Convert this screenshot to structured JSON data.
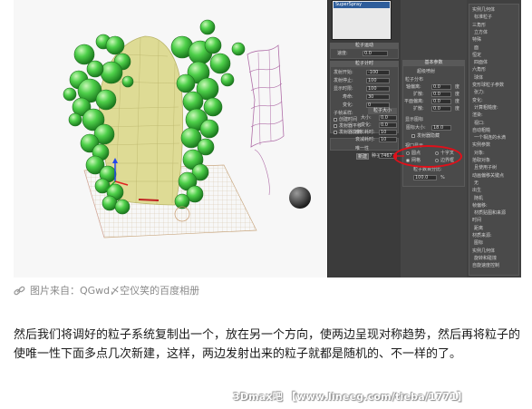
{
  "screenshot": {
    "object_list": {
      "selected_item": "SuperSpray"
    },
    "panel_left": {
      "top_labels": [
        "粒子运动"
      ],
      "top_rows": [
        {
          "label": "速度:",
          "value": "0.0"
        },
        {
          "label": "变化:",
          "value": "0.0"
        },
        {
          "label": "",
          "value": ""
        }
      ],
      "timing_title": "粒子计时",
      "timing_rows": [
        {
          "label": "发射开始:",
          "value": "-100"
        },
        {
          "label": "发射停止:",
          "value": "100"
        },
        {
          "label": "显示时限:",
          "value": "100"
        },
        {
          "label": "寿命:",
          "value": "30"
        },
        {
          "label": "变化:",
          "value": "0"
        }
      ],
      "subframe_title": "子帧采样:",
      "subframe_checks": [
        "创建时间",
        "发射器平移",
        "发射器旋转"
      ],
      "size_title": "粒子大小",
      "size_rows": [
        {
          "label": "大小:",
          "value": "0.0"
        },
        {
          "label": "变化:",
          "value": "0.0"
        },
        {
          "label": "增长耗时:",
          "value": "10"
        },
        {
          "label": "衰减耗时:",
          "value": "10"
        }
      ],
      "unique_title": "唯一性",
      "seed_label": "种子:",
      "seed_value": "7467",
      "new_button": "新建"
    },
    "panel_mid": {
      "basic_title": "基本参数",
      "basic_sub": "超级喷射",
      "particle_dist_title": "粒子分布",
      "dist_rows": [
        {
          "label": "轴偏离:",
          "value": "0.0",
          "unit": "度"
        },
        {
          "label": "扩散:",
          "value": "0.0",
          "unit": "度"
        },
        {
          "label": "平面偏离:",
          "value": "0.0",
          "unit": "度"
        },
        {
          "label": "扩散:",
          "value": "0.0",
          "unit": "度"
        }
      ],
      "icon_title": "显示图标",
      "icon_rows": [
        {
          "label": "图标大小:",
          "value": "18.0"
        }
      ],
      "emitter_hidden": "发射器隐藏",
      "viewport_title": "视口显示",
      "viewport_options": [
        "圆点",
        "十字叉",
        "网格",
        "边界框"
      ],
      "percent_label": "粒子数百分比:",
      "percent_value": "100.0",
      "percent_unit": "%"
    },
    "panel_right": {
      "items": [
        "实例几何体",
        "标准粒子",
        "三角形",
        "立方体",
        "特殊",
        "面",
        "恒定",
        "四面体",
        "六角形",
        "球体",
        "变形球粒子参数",
        "张力:",
        "变化:",
        "计算粗糙度:",
        "渲染:",
        "视口:",
        "自动粗糙",
        "一个相连的水滴",
        "实例参数",
        "对象:",
        "拾取对象",
        "且使用子树",
        "动画偏移关键点",
        "无",
        "出生",
        "随机",
        "帧偏移:",
        "材质贴图和来源",
        "时间",
        "距离",
        "材质来源:",
        "图标",
        "实例几何体",
        "旋转和碰撞",
        "自旋速度控制"
      ]
    }
  },
  "caption": {
    "icon": "link-icon",
    "text": "图片来自：QGwd〆空仪笑的百度相册"
  },
  "body": {
    "text": "然后我们将调好的粒子系统复制出一个，放在另一个方向，使两边呈现对称趋势，然后再将粒子的使唯一性下面多点几次新建，这样，两边发射出来的粒子就都是随机的、不一样的了。"
  },
  "watermark": {
    "text": "3Dmax吧 【www.lineeg.com/tieba/1771】"
  },
  "colors": {
    "particle_green": "#39c239",
    "cloth_yellow": "#d9d68a",
    "wave_purple": "#b06ea8",
    "highlight_red": "#e0101a",
    "panel_gray": "#454545"
  }
}
